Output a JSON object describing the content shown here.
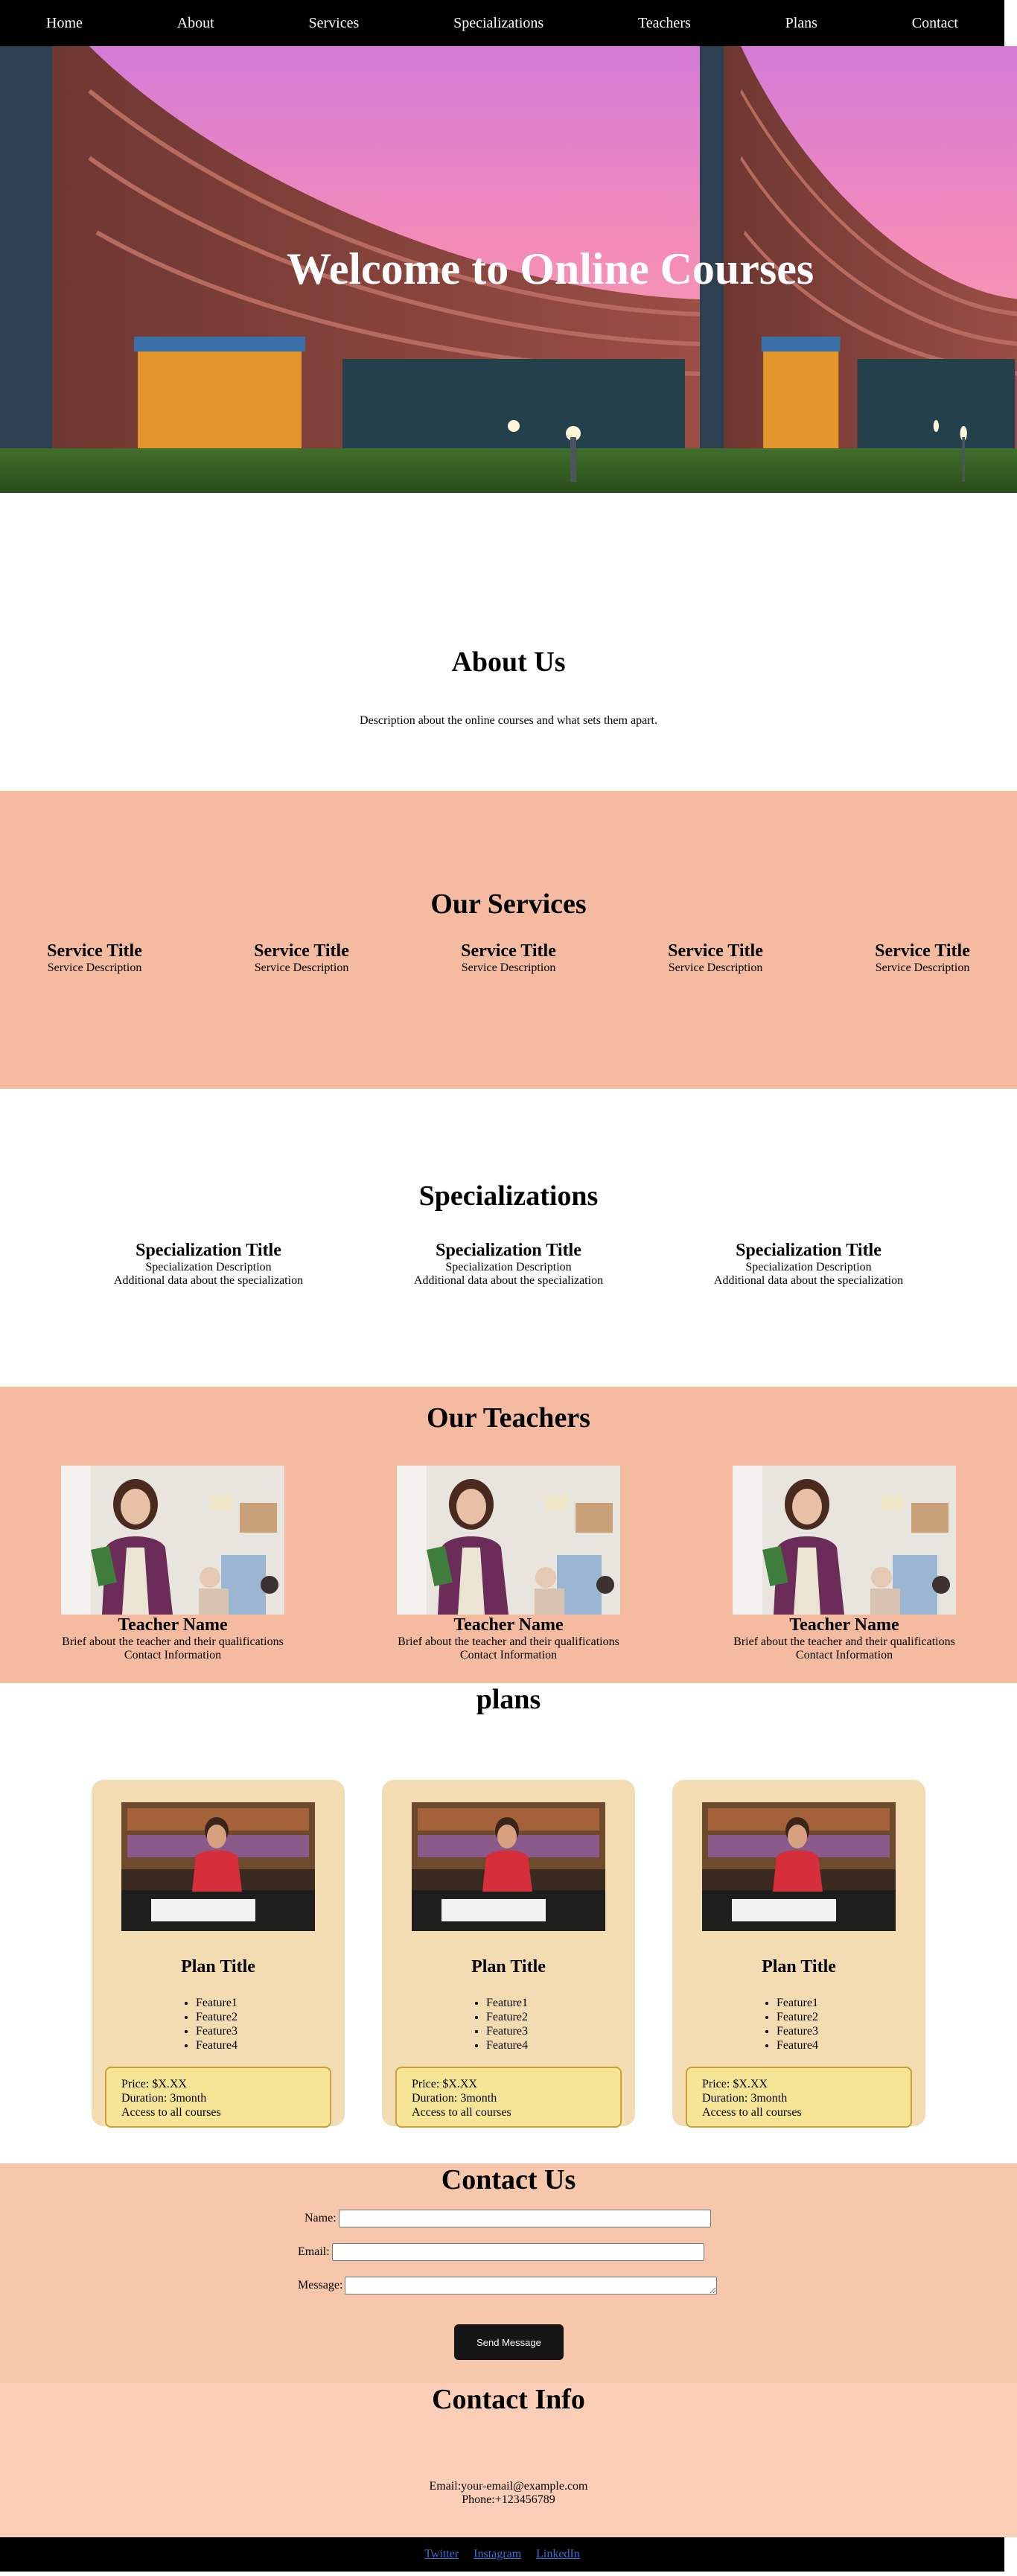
{
  "nav": {
    "items": [
      "Home",
      "About",
      "Services",
      "Specializations",
      "Teachers",
      "Plans",
      "Contact"
    ]
  },
  "hero": {
    "title": "Welcome to Online Courses"
  },
  "about": {
    "title": "About Us",
    "text": "Description about the online courses and what sets them apart."
  },
  "services": {
    "title": "Our Services",
    "items": [
      {
        "title": "Service Title",
        "desc": "Service Description"
      },
      {
        "title": "Service Title",
        "desc": "Service Description"
      },
      {
        "title": "Service Title",
        "desc": "Service Description"
      },
      {
        "title": "Service Title",
        "desc": "Service Description"
      },
      {
        "title": "Service Title",
        "desc": "Service Description"
      }
    ]
  },
  "specializations": {
    "title": "Specializations",
    "items": [
      {
        "title": "Specialization Title",
        "desc": "Specialization Description",
        "extra": "Additional data about the specialization"
      },
      {
        "title": "Specialization Title",
        "desc": "Specialization Description",
        "extra": "Additional data about the specialization"
      },
      {
        "title": "Specialization Title",
        "desc": "Specialization Description",
        "extra": "Additional data about the specialization"
      }
    ]
  },
  "teachers": {
    "title": "Our Teachers",
    "items": [
      {
        "name": "Teacher Name",
        "bio": "Brief about the teacher and their qualifications",
        "contact": "Contact Information"
      },
      {
        "name": "Teacher Name",
        "bio": "Brief about the teacher and their qualifications",
        "contact": "Contact Information"
      },
      {
        "name": "Teacher Name",
        "bio": "Brief about the teacher and their qualifications",
        "contact": "Contact Information"
      }
    ]
  },
  "plans": {
    "title": "plans",
    "items": [
      {
        "title": "Plan Title",
        "features": [
          "Feature1",
          "Feature2",
          "Feature3",
          "Feature4"
        ],
        "price": "Price: $X.XX",
        "duration": "Duration: 3month",
        "access": "Access to all courses"
      },
      {
        "title": "Plan Title",
        "features": [
          "Feature1",
          "Feature2",
          "Feature3",
          "Feature4"
        ],
        "price": "Price: $X.XX",
        "duration": "Duration: 3month",
        "access": "Access to all courses"
      },
      {
        "title": "Plan Title",
        "features": [
          "Feature1",
          "Feature2",
          "Feature3",
          "Feature4"
        ],
        "price": "Price: $X.XX",
        "duration": "Duration: 3month",
        "access": "Access to all courses"
      }
    ]
  },
  "contact": {
    "title": "Contact Us",
    "name_label": "Name:",
    "email_label": "Email:",
    "message_label": "Message:",
    "name_value": "",
    "email_value": "",
    "message_value": "",
    "send_label": "Send Message"
  },
  "contact_info": {
    "title": "Contact Info",
    "email": "Email:your-email@example.com",
    "phone": "Phone:+123456789"
  },
  "footer": {
    "links": [
      "Twitter",
      "Instagram",
      "LinkedIn"
    ]
  },
  "colors": {
    "nav_bg": "#000000",
    "services_bg": "#f4bba0",
    "teachers_bg": "#f4bba0",
    "plan_card_bg": "#f3dcb1",
    "price_box_bg": "#f6e597",
    "contact_bg": "#f6c7ab",
    "contact_info_bg": "#fbcfb7",
    "button_bg": "#161616",
    "footer_link": "#3d6fd6"
  }
}
